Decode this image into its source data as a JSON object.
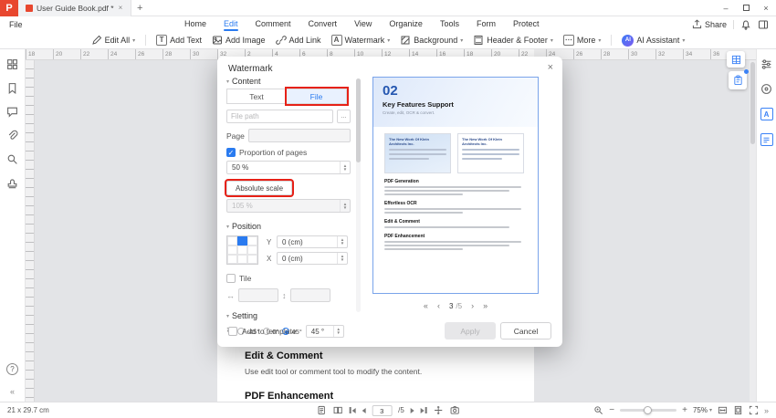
{
  "titlebar": {
    "tab_title": "User Guide Book.pdf *"
  },
  "menubar": {
    "file": "File",
    "tabs": [
      {
        "label": "Home"
      },
      {
        "label": "Edit",
        "active": true
      },
      {
        "label": "Comment"
      },
      {
        "label": "Convert"
      },
      {
        "label": "View"
      },
      {
        "label": "Organize"
      },
      {
        "label": "Tools"
      },
      {
        "label": "Form"
      },
      {
        "label": "Protect"
      }
    ],
    "share": "Share"
  },
  "toolbar": {
    "edit_all": "Edit All",
    "add_text": "Add Text",
    "add_image": "Add Image",
    "add_link": "Add Link",
    "watermark": "Watermark",
    "background": "Background",
    "header_footer": "Header & Footer",
    "more": "More",
    "ai_assistant": "AI Assistant"
  },
  "ruler": {
    "numbers": [
      "18",
      "20",
      "22",
      "24",
      "26",
      "28",
      "30",
      "32",
      "2",
      "4",
      "6",
      "8",
      "10",
      "12",
      "14",
      "16",
      "18",
      "20",
      "22",
      "24",
      "26",
      "28",
      "30",
      "32",
      "34",
      "36"
    ]
  },
  "dialog": {
    "title": "Watermark",
    "content_section": "Content",
    "text_tab": "Text",
    "file_tab": "File",
    "file_path_placeholder": "File path",
    "page_label": "Page",
    "proportion_label": "Proportion of pages",
    "proportion_value": "50 %",
    "absolute_scale": "Absolute scale",
    "absolute_value": "105 %",
    "position_section": "Position",
    "y_label": "Y",
    "y_value": "0 (cm)",
    "x_label": "X",
    "x_value": "0 (cm)",
    "tile_label": "Tile",
    "setting_section": "Setting",
    "rotation_options": [
      "-45°",
      "0°",
      "45°"
    ],
    "rotation_selected": "45°",
    "rotation_custom": "45 °",
    "pager_current": "3",
    "pager_total": "/5",
    "add_to_template": "Add to template",
    "apply": "Apply",
    "cancel": "Cancel"
  },
  "preview": {
    "number": "02",
    "title": "Key Features Support",
    "subtitle": "Create, edit, OCR & convert.",
    "thumb_caption_1": "The New Work Of Klein Architects Inc.",
    "thumb_caption_2": "The New Work Of Klein Architects Inc.",
    "sections": [
      {
        "heading": "PDF Generation"
      },
      {
        "heading": "Effortless OCR"
      },
      {
        "heading": "Edit & Comment"
      },
      {
        "heading": "PDF Enhancement"
      }
    ]
  },
  "document": {
    "heading1": "Edit & Comment",
    "body1": "Use edit tool or comment tool to modify the content.",
    "heading2": "PDF Enhancement"
  },
  "statusbar": {
    "page_size": "21 x 29.7 cm",
    "page_current": "3",
    "page_total": "/5",
    "zoom": "75%"
  },
  "icons": {
    "logo": "P",
    "new_tab": "+",
    "minimize": "–",
    "close": "×",
    "caret_down": "▾",
    "add_text": "T",
    "watermark_letter": "A",
    "more": "⋯",
    "ai_badge": "AI",
    "ellipsis": "...",
    "check": "✓",
    "rotate": "↻",
    "h_spacing": "↔",
    "v_spacing": "↕",
    "first": "«",
    "prev": "‹",
    "next": "›",
    "last": "»",
    "minus": "−",
    "plus": "+",
    "help": "?",
    "collapse_left": "«",
    "collapse_right": "»",
    "translate": "A"
  },
  "colors": {
    "accent": "#2a7bf0",
    "annotation": "#e62117",
    "logo_red": "#e8472f"
  }
}
